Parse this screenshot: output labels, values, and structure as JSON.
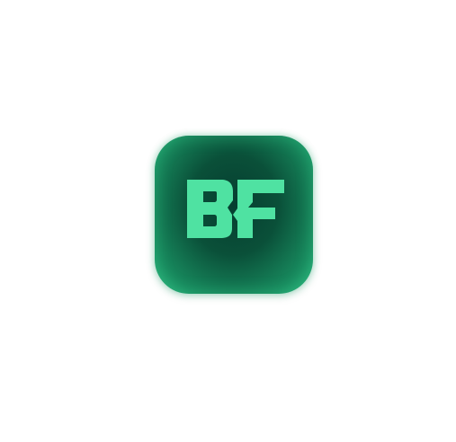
{
  "logo": {
    "text": "BF",
    "icon": "bf-letter-logo-icon",
    "colors": {
      "background_dark": "#063e30",
      "background_light": "#2bb47d",
      "mark": "#4fe2a2",
      "page_background": "#ffffff"
    }
  }
}
